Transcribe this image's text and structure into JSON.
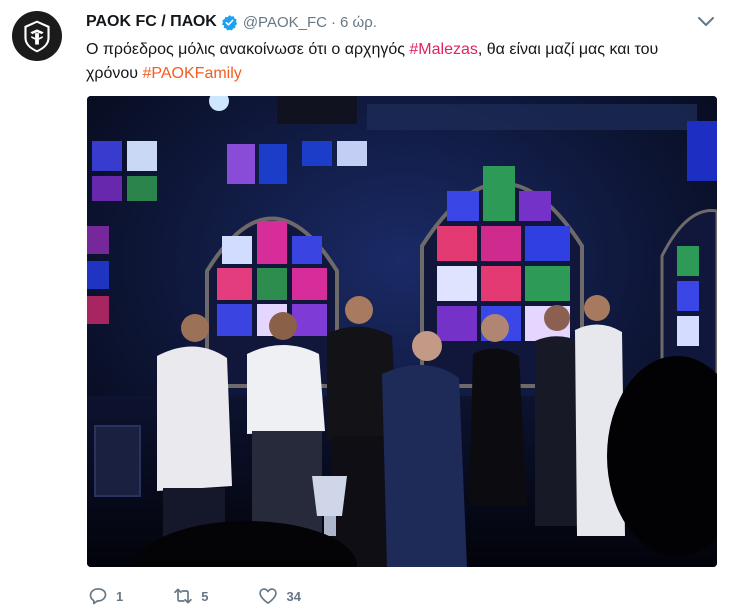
{
  "tweet": {
    "display_name": "PAOK FC / ΠΑΟΚ",
    "handle": "@PAOK_FC",
    "separator": "·",
    "time": "6 ώρ.",
    "text_part1": "Ο πρόεδρος μόλις ανακοίνωσε ότι ο αρχηγός ",
    "hashtag1": "#Malezas",
    "text_part2": ", θα είναι μαζί μας και του χρόνου ",
    "hashtag2": "#PAOKFamily"
  },
  "actions": {
    "replies": "1",
    "retweets": "5",
    "likes": "34"
  },
  "colors": {
    "text": "#14171a",
    "secondary": "#657786",
    "hashtag": "#e0245e",
    "verified": "#1da1f2"
  },
  "icons": {
    "avatar": "paok-logo-icon",
    "verified": "verified-badge-icon",
    "menu": "chevron-down-icon",
    "reply": "reply-icon",
    "retweet": "retweet-icon",
    "like": "heart-icon"
  }
}
